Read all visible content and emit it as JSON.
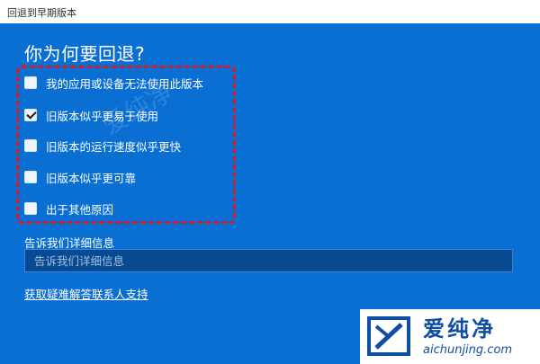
{
  "window": {
    "title": "回退到早期版本"
  },
  "dialog": {
    "heading": "你为何要回退?",
    "options": [
      {
        "label": "我的应用或设备无法使用此版本",
        "checked": false
      },
      {
        "label": "旧版本似乎更易于使用",
        "checked": true
      },
      {
        "label": "旧版本的运行速度似乎更快",
        "checked": false
      },
      {
        "label": "旧版本似乎更可靠",
        "checked": false
      },
      {
        "label": "出于其他原因",
        "checked": false
      }
    ],
    "details_label": "告诉我们详细信息",
    "details_placeholder": "告诉我们详细信息",
    "help_link": "获取疑难解答联系人支持"
  },
  "watermark": {
    "center_text": "爱纯净",
    "name": "爱纯净",
    "url": "aichunjing.com"
  },
  "colors": {
    "panel": "#0a6fd3",
    "highlight_border": "#d01d2a",
    "input_bg": "#084a92",
    "brand": "#0f4fa3"
  }
}
